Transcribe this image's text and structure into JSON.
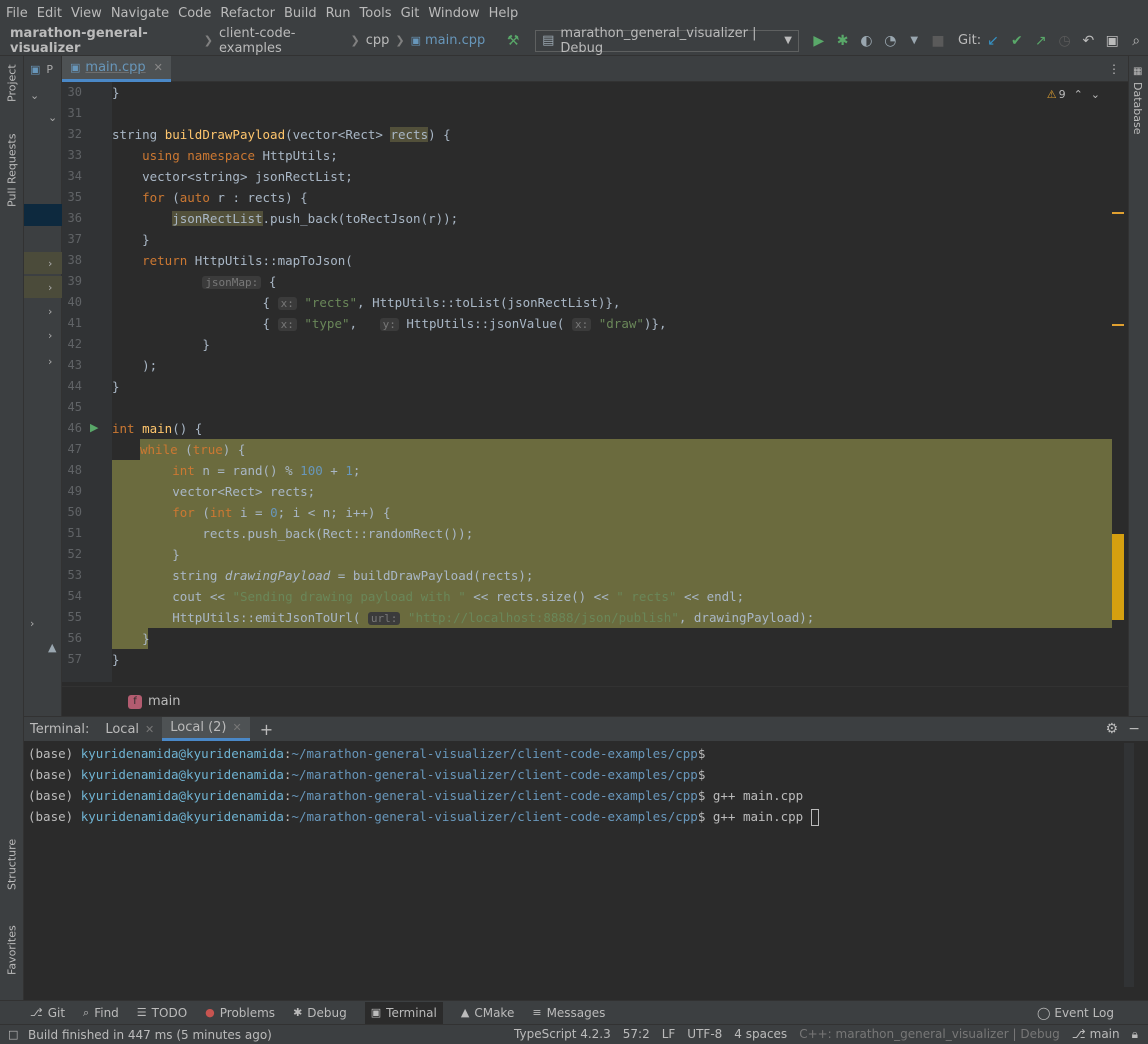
{
  "menu": [
    "File",
    "Edit",
    "View",
    "Navigate",
    "Code",
    "Refactor",
    "Build",
    "Run",
    "Tools",
    "Git",
    "Window",
    "Help"
  ],
  "breadcrumb": {
    "project": "marathon-general-visualizer",
    "folder1": "client-code-examples",
    "folder2": "cpp",
    "file": "main.cpp"
  },
  "run_config": "marathon_general_visualizer | Debug",
  "git_label": "Git:",
  "left_tabs": {
    "project": "Project",
    "pull_requests": "Pull Requests",
    "structure": "Structure",
    "favorites": "Favorites"
  },
  "right_tabs": {
    "database": "Database"
  },
  "editor": {
    "project_tab_short": "P",
    "tab_label": "main.cpp",
    "warnings_count": "9",
    "breadcrumb_fn": "main",
    "line_numbers": [
      "30",
      "31",
      "32",
      "33",
      "34",
      "35",
      "36",
      "37",
      "38",
      "39",
      "40",
      "41",
      "42",
      "43",
      "44",
      "45",
      "46",
      "47",
      "48",
      "49",
      "50",
      "51",
      "52",
      "53",
      "54",
      "55",
      "56",
      "57"
    ]
  },
  "code": {
    "l30": "}",
    "l32_a": "string ",
    "l32_fn": "buildDrawPayload",
    "l32_b": "(vector<Rect> ",
    "l32_c": "rects",
    "l32_d": ") {",
    "l33_kw": "using namespace ",
    "l33_b": "HttpUtils;",
    "l34": "vector<string> jsonRectList;",
    "l35_kw": "for ",
    "l35_b": "(",
    "l35_kw2": "auto ",
    "l35_c": "r : rects) {",
    "l36_a": "jsonRectList",
    "l36_b": ".push_back(toRectJson(r));",
    "l37": "}",
    "l38_kw": "return ",
    "l38_b": "HttpUtils::mapToJson(",
    "l39_hint": "jsonMap:",
    "l39_b": " {",
    "l40_a": "{ ",
    "l40_hint": "x:",
    "l40_str": " \"rects\"",
    "l40_b": ", HttpUtils::toList(jsonRectList)},",
    "l41_a": "{ ",
    "l41_hint": "x:",
    "l41_str": " \"type\"",
    "l41_b": ",   ",
    "l41_hint2": "y:",
    "l41_c": " HttpUtils::jsonValue( ",
    "l41_hint3": "x:",
    "l41_str2": " \"draw\"",
    "l41_d": ")},",
    "l42": "}",
    "l43": ");",
    "l44": "}",
    "l46_kw": "int ",
    "l46_fn": "main",
    "l46_b": "() {",
    "l47_kw": "while ",
    "l47_b": "(",
    "l47_kw2": "true",
    "l47_c": ") {",
    "l48_kw": "int ",
    "l48_b": "n = rand() % ",
    "l48_n1": "100",
    "l48_c": " + ",
    "l48_n2": "1",
    "l48_d": ";",
    "l49": "vector<Rect> rects;",
    "l50_kw": "for ",
    "l50_b": "(",
    "l50_kw2": "int ",
    "l50_c": "i = ",
    "l50_n": "0",
    "l50_d": "; i < n; i++) {",
    "l51": "rects.push_back(Rect::randomRect());",
    "l52": "}",
    "l53_a": "string ",
    "l53_b": "drawingPayload",
    "l53_c": " = buildDrawPayload(rects);",
    "l54_a": "cout << ",
    "l54_str": "\"Sending drawing payload with \"",
    "l54_b": " << rects.size() << ",
    "l54_str2": "\" rects\"",
    "l54_c": " << endl;",
    "l55_a": "HttpUtils::emitJsonToUrl( ",
    "l55_hint": "url:",
    "l55_str": " \"http://localhost:8888/json/publish\"",
    "l55_b": ", drawingPayload);",
    "l56": "}",
    "l57": "}"
  },
  "terminal": {
    "title": "Terminal:",
    "tabs": [
      "Local",
      "Local (2)"
    ],
    "prefix": "(base) ",
    "user": "kyuridenamida@kyuridenamida",
    "colon": ":",
    "path": "~/marathon-general-visualizer/client-code-examples/cpp",
    "dollar": "$",
    "lines": [
      "",
      "",
      " g++ main.cpp",
      " g++ main.cpp"
    ]
  },
  "bottom_tools": [
    "Git",
    "Find",
    "TODO",
    "Problems",
    "Debug",
    "Terminal",
    "CMake",
    "Messages"
  ],
  "event_log": "Event Log",
  "status": {
    "build": "Build finished in 447 ms (5 minutes ago)",
    "lang": "TypeScript 4.2.3",
    "pos": "57:2",
    "eol": "LF",
    "enc": "UTF-8",
    "indent": "4 spaces",
    "ctx": "C++: marathon_general_visualizer | Debug",
    "branch": "main"
  }
}
